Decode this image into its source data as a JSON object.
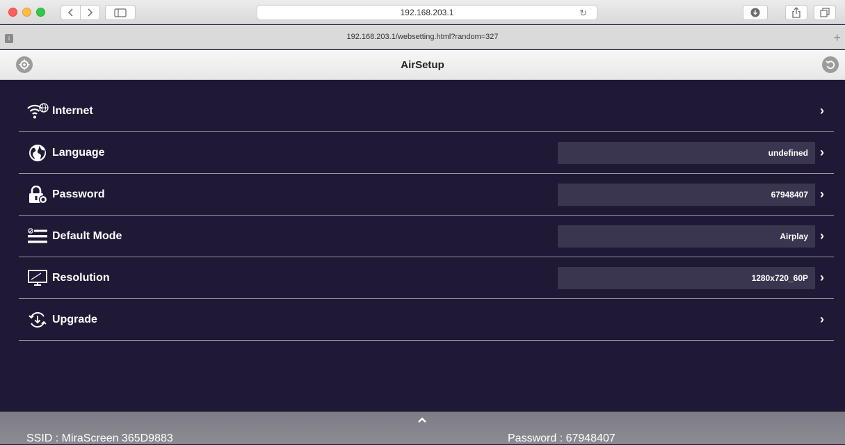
{
  "browser": {
    "address": "192.168.203.1",
    "tab_title": "192.168.203.1/websetting.html?random=327"
  },
  "app": {
    "title": "AirSetup"
  },
  "menu": {
    "items": [
      {
        "label": "Internet",
        "value": null,
        "icon": "wifi-globe-icon"
      },
      {
        "label": "Language",
        "value": "undefined",
        "icon": "globe-icon"
      },
      {
        "label": "Password",
        "value": "67948407",
        "icon": "lock-icon"
      },
      {
        "label": "Default Mode",
        "value": "Airplay",
        "icon": "mode-list-icon"
      },
      {
        "label": "Resolution",
        "value": "1280x720_60P",
        "icon": "monitor-icon"
      },
      {
        "label": "Upgrade",
        "value": null,
        "icon": "upgrade-icon"
      }
    ]
  },
  "footer": {
    "ssid": "SSID : MiraScreen 365D9883",
    "password": "Password : 67948407"
  },
  "colors": {
    "background": "#1f1935",
    "value_box": "#3b3650",
    "divider": "#9a97a8",
    "footer": "#85838b"
  }
}
